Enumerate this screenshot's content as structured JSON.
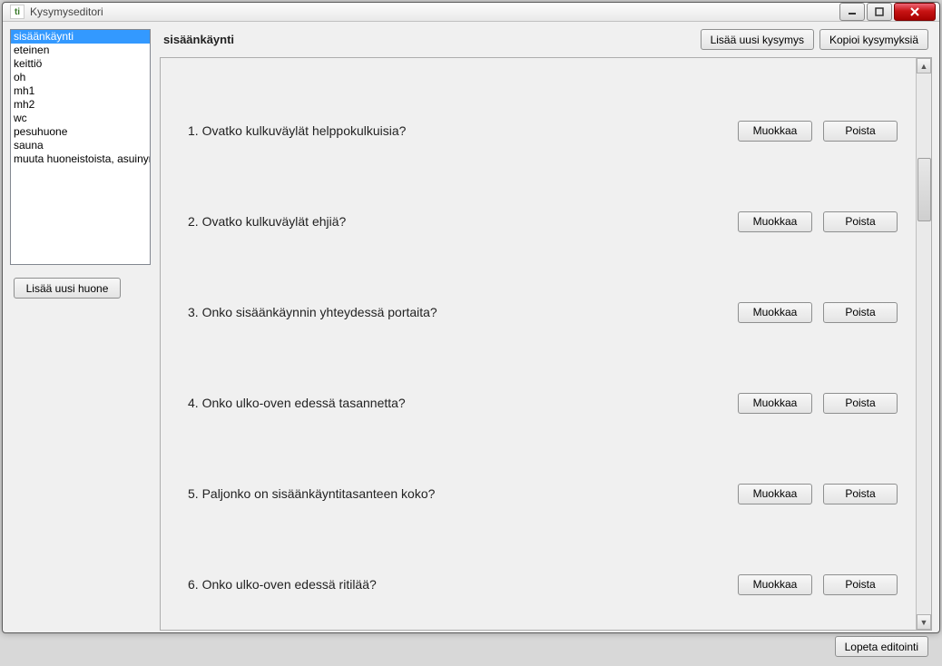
{
  "window": {
    "title": "Kysymyseditori"
  },
  "sidebar": {
    "rooms": [
      "sisäänkäynti",
      "eteinen",
      "keittiö",
      "oh",
      "mh1",
      "mh2",
      "wc",
      "pesuhuone",
      "sauna",
      "muuta huoneistoista, asuinympäristöstä"
    ],
    "selected_index": 0,
    "add_room_label": "Lisää uusi huone"
  },
  "header": {
    "title": "sisäänkäynti",
    "add_question_label": "Lisää uusi kysymys",
    "copy_questions_label": "Kopioi kysymyksiä"
  },
  "questions": [
    {
      "text": "1. Ovatko kulkuväylät helppokulkuisia?"
    },
    {
      "text": "2. Ovatko kulkuväylät ehjiä?"
    },
    {
      "text": "3. Onko sisäänkäynnin yhteydessä portaita?"
    },
    {
      "text": "4. Onko ulko-oven edessä tasannetta?"
    },
    {
      "text": "5. Paljonko on sisäänkäyntitasanteen koko?"
    },
    {
      "text": "6. Onko ulko-oven edessä ritilää?"
    }
  ],
  "buttons": {
    "edit": "Muokkaa",
    "delete": "Poista",
    "finish": "Lopeta editointi"
  }
}
